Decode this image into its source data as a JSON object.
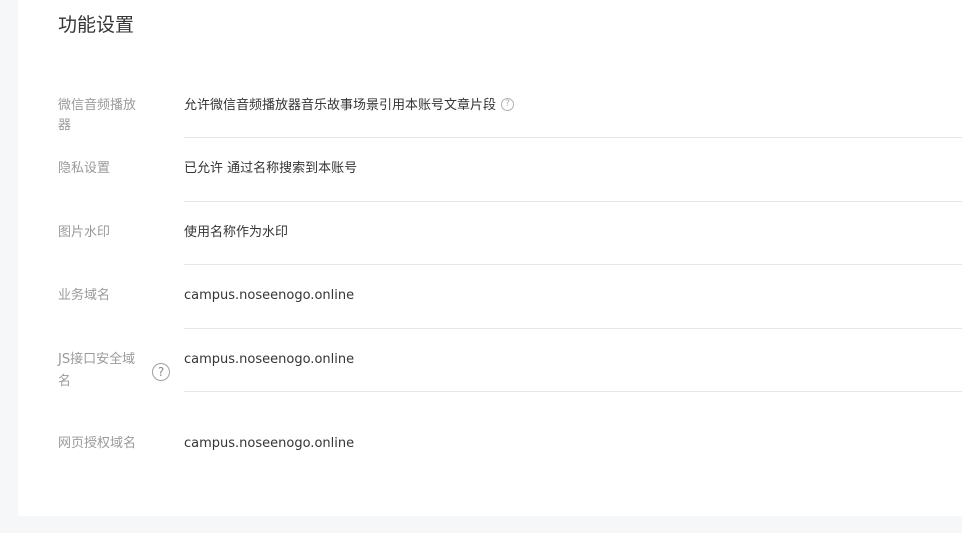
{
  "section": {
    "title": "功能设置"
  },
  "settings": [
    {
      "label": "微信音频播放器",
      "value": "允许微信音频播放器音乐故事场景引用本账号文章片段",
      "has_help": true
    },
    {
      "label": "隐私设置",
      "value": "已允许 通过名称搜索到本账号"
    },
    {
      "label": "图片水印",
      "value": "使用名称作为水印"
    },
    {
      "label": "业务域名",
      "value": "campus.noseenogo.online"
    },
    {
      "label": "JS接口安全域名",
      "value": "campus.noseenogo.online",
      "has_help": true
    },
    {
      "label": "网页授权域名",
      "value": "campus.noseenogo.online"
    }
  ],
  "icons": {
    "help_glyph": "?",
    "help_icon": "question-circle"
  },
  "colors": {
    "page_background": "#f6f7f9",
    "panel_background": "#ffffff",
    "label": "#9a9a9a",
    "value": "#353535",
    "divider": "#e7e7eb"
  }
}
